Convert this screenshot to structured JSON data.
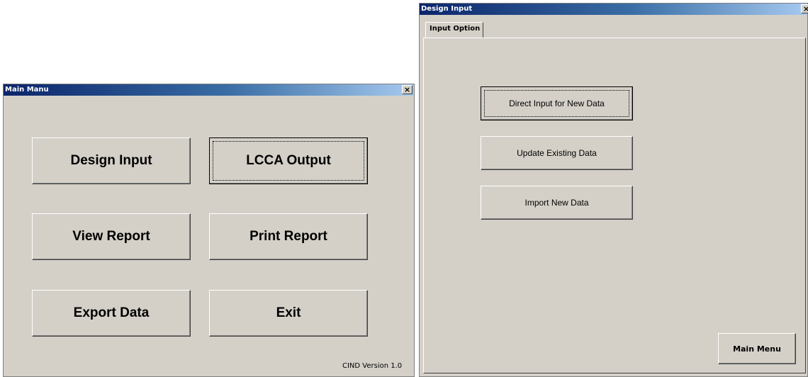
{
  "main_menu": {
    "title": "Main Manu",
    "close_glyph": "×",
    "buttons": {
      "design_input": "Design Input",
      "lcca_output": "LCCA Output",
      "view_report": "View Report",
      "print_report": "Print Report",
      "export_data": "Export Data",
      "exit": "Exit"
    },
    "version": "CIND Version 1.0"
  },
  "design_input": {
    "title": "Design Input",
    "close_glyph": "×",
    "tab_label": "Input Option",
    "buttons": {
      "direct_input": "Direct Input for New Data",
      "update_existing": "Update Existing Data",
      "import_new": "Import New Data",
      "main_menu": "Main Menu"
    }
  },
  "colors": {
    "dialog_face": "#d4d0c8",
    "titlebar_start": "#0a246a",
    "titlebar_end": "#a6caf0"
  }
}
